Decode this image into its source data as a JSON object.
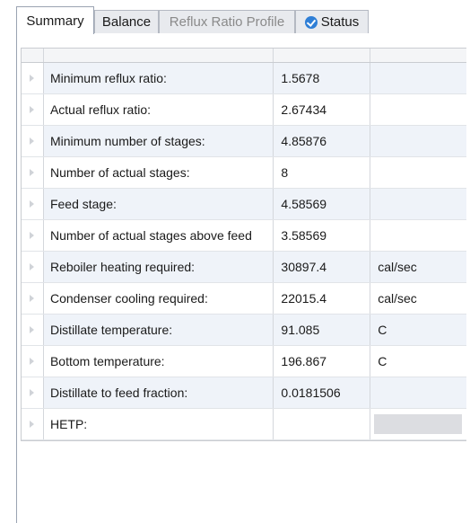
{
  "tabs": [
    {
      "label": "Summary",
      "state": "active"
    },
    {
      "label": "Balance",
      "state": "normal"
    },
    {
      "label": "Reflux Ratio Profile",
      "state": "disabled"
    },
    {
      "label": "Status",
      "state": "normal",
      "icon": "check-circle-icon"
    }
  ],
  "rows": [
    {
      "label": "Minimum reflux ratio:",
      "value": "1.5678",
      "unit": ""
    },
    {
      "label": "Actual reflux ratio:",
      "value": "2.67434",
      "unit": ""
    },
    {
      "label": "Minimum number of stages:",
      "value": "4.85876",
      "unit": ""
    },
    {
      "label": "Number of actual stages:",
      "value": "8",
      "unit": ""
    },
    {
      "label": "Feed stage:",
      "value": "4.58569",
      "unit": ""
    },
    {
      "label": "Number of actual stages above feed",
      "value": "3.58569",
      "unit": ""
    },
    {
      "label": "Reboiler heating required:",
      "value": "30897.4",
      "unit": "cal/sec"
    },
    {
      "label": "Condenser cooling required:",
      "value": "22015.4",
      "unit": "cal/sec"
    },
    {
      "label": "Distillate temperature:",
      "value": "91.085",
      "unit": "C"
    },
    {
      "label": "Bottom temperature:",
      "value": "196.867",
      "unit": "C"
    },
    {
      "label": "Distillate to feed fraction:",
      "value": "0.0181506",
      "unit": ""
    },
    {
      "label": "HETP:",
      "value": "",
      "unit": ""
    }
  ]
}
